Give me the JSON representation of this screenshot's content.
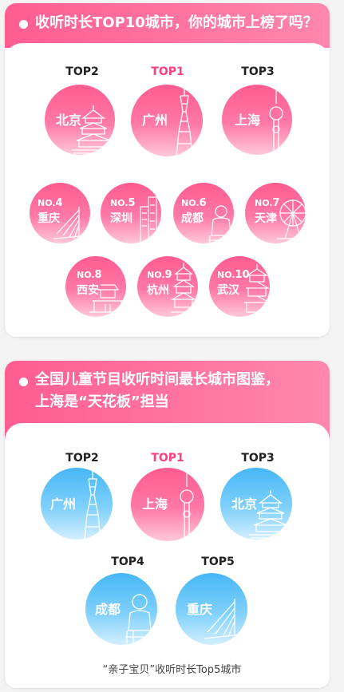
{
  "section1": {
    "title": "收听时长TOP10城市，你的城市上榜了吗？",
    "top3": [
      {
        "rank_label": "TOP2",
        "city": "北京"
      },
      {
        "rank_label": "TOP1",
        "city": "广州"
      },
      {
        "rank_label": "TOP3",
        "city": "上海"
      }
    ],
    "row2": [
      {
        "no_prefix": "NO.",
        "no": "4",
        "city": "重庆"
      },
      {
        "no_prefix": "NO.",
        "no": "5",
        "city": "深圳"
      },
      {
        "no_prefix": "NO.",
        "no": "6",
        "city": "成都"
      },
      {
        "no_prefix": "NO.",
        "no": "7",
        "city": "天津"
      }
    ],
    "row3": [
      {
        "no_prefix": "NO.",
        "no": "8",
        "city": "西安"
      },
      {
        "no_prefix": "NO.",
        "no": "9",
        "city": "杭州"
      },
      {
        "no_prefix": "NO.",
        "no": "10",
        "city": "武汉"
      }
    ]
  },
  "section2": {
    "title_line1": "全国儿童节目收听时间最长城市图鉴，",
    "title_line2": "上海是“天花板”担当",
    "top3": [
      {
        "rank_label": "TOP2",
        "city": "广州"
      },
      {
        "rank_label": "TOP1",
        "city": "上海"
      },
      {
        "rank_label": "TOP3",
        "city": "北京"
      }
    ],
    "row2": [
      {
        "rank_label": "TOP4",
        "city": "成都"
      },
      {
        "rank_label": "TOP5",
        "city": "重庆"
      }
    ],
    "caption": "“亲子宝贝”收听时长Top5城市"
  },
  "colors": {
    "pink": "#ff5c8f",
    "blue": "#47b7f5",
    "top1_label": "#ff3d7f"
  }
}
